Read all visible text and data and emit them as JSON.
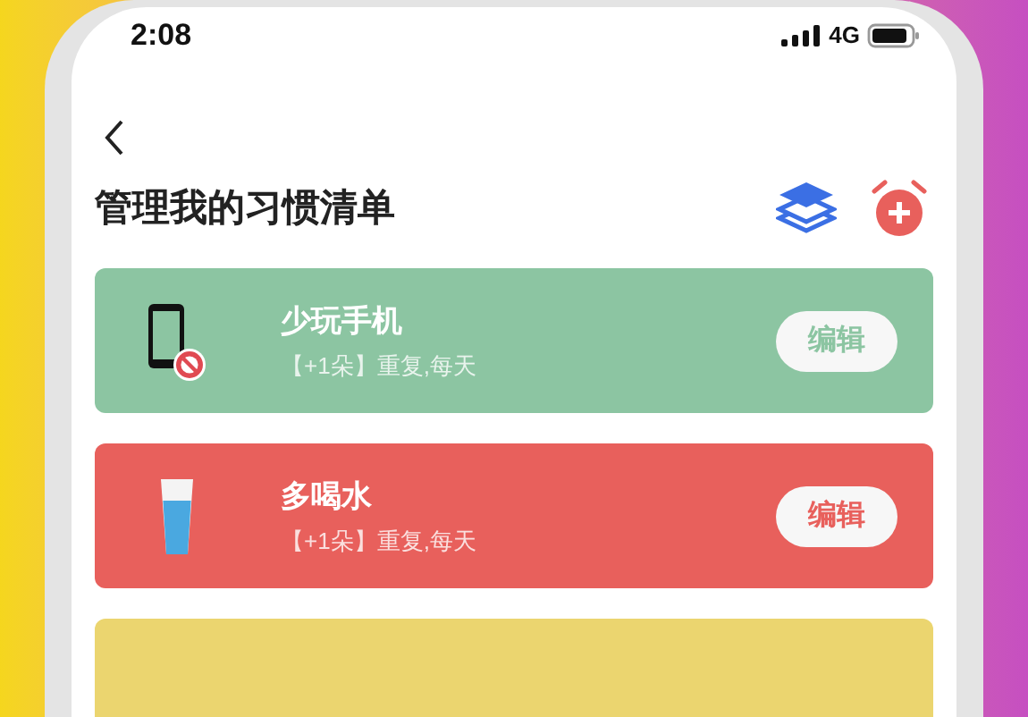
{
  "status_bar": {
    "time": "2:08",
    "network": "4G"
  },
  "header": {
    "title": "管理我的习惯清单"
  },
  "habits": [
    {
      "kind": "phone-blocked",
      "title": "少玩手机",
      "detail": "【+1朵】重复,每天",
      "button": "编辑",
      "color": "#8cc5a2"
    },
    {
      "kind": "water-glass",
      "title": "多喝水",
      "detail": "【+1朵】重复,每天",
      "button": "编辑",
      "color": "#e8605c"
    },
    {
      "kind": "empty",
      "color": "#ebd56f"
    }
  ]
}
